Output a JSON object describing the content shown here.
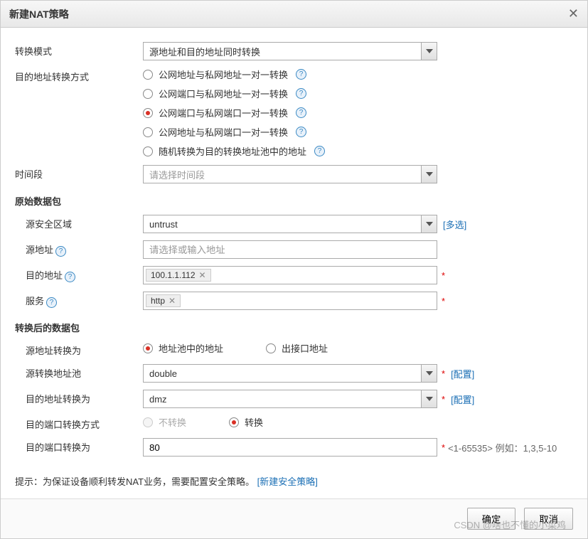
{
  "dialog": {
    "title": "新建NAT策略",
    "close": "✕"
  },
  "mode": {
    "label": "转换模式",
    "value": "源地址和目的地址同时转换"
  },
  "destMethod": {
    "label": "目的地址转换方式",
    "options": [
      "公网地址与私网地址一对一转换",
      "公网端口与私网地址一对一转换",
      "公网端口与私网端口一对一转换",
      "公网地址与私网端口一对一转换",
      "随机转换为目的转换地址池中的地址"
    ],
    "selectedIndex": 2
  },
  "timeRange": {
    "label": "时间段",
    "placeholder": "请选择时间段"
  },
  "section1": "原始数据包",
  "srcZone": {
    "label": "源安全区域",
    "value": "untrust",
    "multi": "[多选]"
  },
  "srcAddr": {
    "label": "源地址",
    "placeholder": "请选择或输入地址"
  },
  "destAddr": {
    "label": "目的地址",
    "tag": "100.1.1.112"
  },
  "service": {
    "label": "服务",
    "tag": "http"
  },
  "section2": "转换后的数据包",
  "srcTransTo": {
    "label": "源地址转换为",
    "opt1": "地址池中的地址",
    "opt2": "出接口地址"
  },
  "srcPool": {
    "label": "源转换地址池",
    "value": "double",
    "config": "[配置]"
  },
  "destTransTo": {
    "label": "目的地址转换为",
    "value": "dmz",
    "config": "[配置]"
  },
  "destPortMethod": {
    "label": "目的端口转换方式",
    "opt1": "不转换",
    "opt2": "转换"
  },
  "destPortTo": {
    "label": "目的端口转换为",
    "value": "80",
    "hint": "<1-65535>  例如：1,3,5-10"
  },
  "bottomHint": {
    "text": "提示：为保证设备顺利转发NAT业务，需要配置安全策略。",
    "link": "[新建安全策略]"
  },
  "buttons": {
    "ok": "确定",
    "cancel": "取消"
  },
  "watermark": "CSDN @啥也不懂的小菜鸡",
  "help": "?",
  "tagX": "✕"
}
